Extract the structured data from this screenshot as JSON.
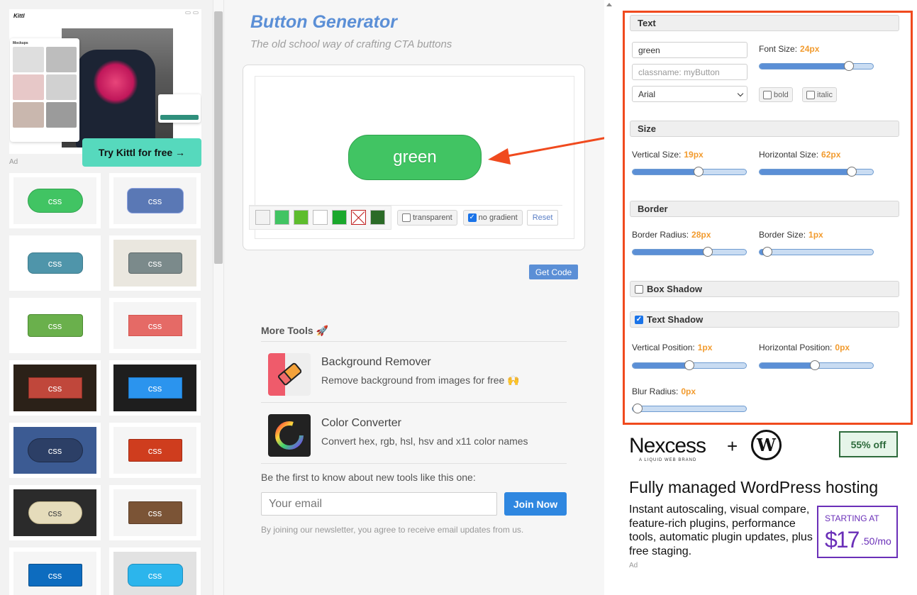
{
  "left_ad": {
    "cta": "Try Kittl for free →",
    "label": "Ad",
    "logo": "Kittl",
    "mockups_title": "Mockups"
  },
  "samples": [
    {
      "label": "css",
      "bg": "#41c463",
      "border": "#2fa24d",
      "radius": 18,
      "panel": "#f5f5f5"
    },
    {
      "label": "css",
      "bg": "#5a78b5",
      "border": "#8ea3e0",
      "radius": 8,
      "panel": "#f5f5f5"
    },
    {
      "label": "css",
      "bg": "#4f95aa",
      "border": "#3d7b8d",
      "radius": 8,
      "panel": "#ffffff"
    },
    {
      "label": "css",
      "bg": "#7b8a8b",
      "border": "#5e6a6b",
      "radius": 4,
      "panel": "#eae7df"
    },
    {
      "label": "css",
      "bg": "#6ab04c",
      "border": "#4a8a2f",
      "radius": 4,
      "panel": "#ffffff"
    },
    {
      "label": "css",
      "bg": "#e56a66",
      "border": "#d4544f",
      "radius": 0,
      "panel": "#f5f5f5"
    },
    {
      "label": "css",
      "bg": "#c0473b",
      "border": "#8c2d24",
      "radius": 0,
      "panel": "#2b2118"
    },
    {
      "label": "css",
      "bg": "#2b94ee",
      "border": "#1a76c6",
      "radius": 0,
      "panel": "#1e1e1e"
    },
    {
      "label": "css",
      "bg": "#2c3f66",
      "border": "#1e2b47",
      "radius": 18,
      "panel": "#3c5b93"
    },
    {
      "label": "css",
      "bg": "#cf3d1e",
      "border": "#a32b12",
      "radius": 2,
      "panel": "#f5f5f5"
    },
    {
      "label": "css",
      "bg": "#e5dcbb",
      "border": "#bfb38a",
      "radius": 18,
      "panel": "#2b2b2b",
      "color": "#444"
    },
    {
      "label": "css",
      "bg": "#7b5436",
      "border": "#5b3d26",
      "radius": 2,
      "panel": "#f5f5f5"
    },
    {
      "label": "css",
      "bg": "#0d6cbf",
      "border": "#0a4f8c",
      "radius": 2,
      "panel": "#f5f5f5"
    },
    {
      "label": "css",
      "bg": "#2cb5ec",
      "border": "#1d8fc0",
      "radius": 8,
      "panel": "#e2e2e2"
    }
  ],
  "header": {
    "title": "Button Generator",
    "subtitle": "The old school way of crafting CTA buttons"
  },
  "preview": {
    "button_text": "green",
    "swatch_colors": [
      "#f2f2f2",
      "#41c463",
      "#5dbd2d",
      "#ffffff",
      "#1aa82c",
      "x",
      "#2b6b27"
    ],
    "transparent_label": "transparent",
    "no_gradient_label": "no gradient",
    "reset_label": "Reset",
    "get_code_label": "Get Code"
  },
  "more_tools": {
    "title": "More Tools 🚀",
    "items": [
      {
        "title": "Background Remover",
        "desc": "Remove background from images for free 🙌"
      },
      {
        "title": "Color Converter",
        "desc": "Convert hex, rgb, hsl, hsv and x11 color names"
      }
    ]
  },
  "newsletter": {
    "text": "Be the first to know about new tools like this one:",
    "placeholder": "Your email",
    "button": "Join Now",
    "fine_print": "By joining our newsletter, you agree to receive email updates from us."
  },
  "controls": {
    "text_section": "Text",
    "text_value": "green",
    "classname_placeholder": "classname: myButton",
    "font_family": "Arial",
    "font_size_label": "Font Size:",
    "font_size_value": "24px",
    "font_size_level": 0.79,
    "bold_label": "bold",
    "italic_label": "italic",
    "size_section": "Size",
    "vsize_label": "Vertical Size:",
    "vsize_value": "19px",
    "vsize_level": 0.58,
    "hsize_label": "Horizontal Size:",
    "hsize_value": "62px",
    "hsize_level": 0.81,
    "border_section": "Border",
    "radius_label": "Border Radius:",
    "radius_value": "28px",
    "radius_level": 0.66,
    "bsize_label": "Border Size:",
    "bsize_value": "1px",
    "bsize_level": 0.07,
    "box_shadow_section": "Box Shadow",
    "text_shadow_section": "Text Shadow",
    "tvpos_label": "Vertical Position:",
    "tvpos_value": "1px",
    "tvpos_level": 0.5,
    "thpos_label": "Horizontal Position:",
    "thpos_value": "0px",
    "thpos_level": 0.49,
    "blur_label": "Blur Radius:",
    "blur_value": "0px",
    "blur_level": 0.0
  },
  "right_ad": {
    "brand": "Nexcess",
    "brand_sub": "A LIQUID WEB BRAND",
    "plus": "+",
    "wp": "W",
    "badge": "55% off",
    "headline": "Fully managed WordPress hosting",
    "body": "Instant autoscaling, visual compare, feature-rich plugins, performance tools, automatic plugin updates, plus free staging.",
    "price_start": "STARTING AT",
    "price": "$17",
    "price_unit": ".50/mo",
    "label": "Ad"
  },
  "colors": {
    "accent": "#5b8fd6",
    "highlight_border": "#f04a1e",
    "value_orange": "#f29b2e",
    "preview_green": "#41c463"
  }
}
